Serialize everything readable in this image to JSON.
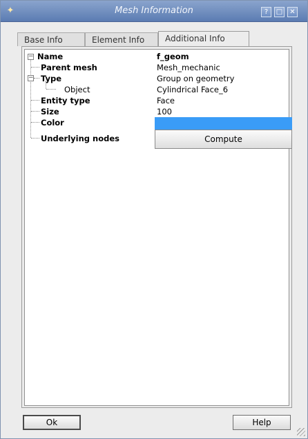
{
  "window": {
    "title": "Mesh Information",
    "controls": {
      "help": "?",
      "maximize": "□",
      "close": "✕"
    }
  },
  "tabs": [
    {
      "label": "Base Info"
    },
    {
      "label": "Element Info"
    },
    {
      "label": "Additional Info"
    }
  ],
  "tree": {
    "name_key": "Name",
    "name_value": "f_geom",
    "parent_mesh_key": "Parent mesh",
    "parent_mesh_value": "Mesh_mechanic",
    "type_key": "Type",
    "type_value": "Group on geometry",
    "object_key": "Object",
    "object_value": "Cylindrical Face_6",
    "entity_type_key": "Entity type",
    "entity_type_value": "Face",
    "size_key": "Size",
    "size_value": "100",
    "color_key": "Color",
    "color_value": "#3a9cf7",
    "underlying_nodes_key": "Underlying nodes",
    "compute_label": "Compute"
  },
  "buttons": {
    "ok": "Ok",
    "help": "Help"
  }
}
